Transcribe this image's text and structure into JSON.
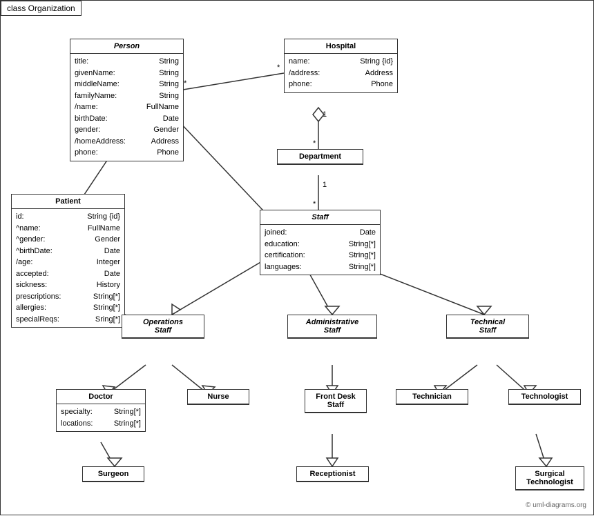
{
  "title": "class Organization",
  "copyright": "© uml-diagrams.org",
  "classes": {
    "person": {
      "name": "Person",
      "italic": true,
      "attrs": [
        [
          "title:",
          "String"
        ],
        [
          "givenName:",
          "String"
        ],
        [
          "middleName:",
          "String"
        ],
        [
          "familyName:",
          "String"
        ],
        [
          "/name:",
          "FullName"
        ],
        [
          "birthDate:",
          "Date"
        ],
        [
          "gender:",
          "Gender"
        ],
        [
          "/homeAddress:",
          "Address"
        ],
        [
          "phone:",
          "Phone"
        ]
      ]
    },
    "hospital": {
      "name": "Hospital",
      "italic": false,
      "attrs": [
        [
          "name:",
          "String {id}"
        ],
        [
          "/address:",
          "Address"
        ],
        [
          "phone:",
          "Phone"
        ]
      ]
    },
    "patient": {
      "name": "Patient",
      "italic": false,
      "attrs": [
        [
          "id:",
          "String {id}"
        ],
        [
          "^name:",
          "FullName"
        ],
        [
          "^gender:",
          "Gender"
        ],
        [
          "^birthDate:",
          "Date"
        ],
        [
          "/age:",
          "Integer"
        ],
        [
          "accepted:",
          "Date"
        ],
        [
          "sickness:",
          "History"
        ],
        [
          "prescriptions:",
          "String[*]"
        ],
        [
          "allergies:",
          "String[*]"
        ],
        [
          "specialReqs:",
          "Sring[*]"
        ]
      ]
    },
    "department": {
      "name": "Department",
      "italic": false,
      "attrs": []
    },
    "staff": {
      "name": "Staff",
      "italic": true,
      "attrs": [
        [
          "joined:",
          "Date"
        ],
        [
          "education:",
          "String[*]"
        ],
        [
          "certification:",
          "String[*]"
        ],
        [
          "languages:",
          "String[*]"
        ]
      ]
    },
    "operations_staff": {
      "name": "Operations\nStaff",
      "italic": true,
      "attrs": []
    },
    "administrative_staff": {
      "name": "Administrative\nStaff",
      "italic": true,
      "attrs": []
    },
    "technical_staff": {
      "name": "Technical\nStaff",
      "italic": true,
      "attrs": []
    },
    "doctor": {
      "name": "Doctor",
      "italic": false,
      "attrs": [
        [
          "specialty:",
          "String[*]"
        ],
        [
          "locations:",
          "String[*]"
        ]
      ]
    },
    "nurse": {
      "name": "Nurse",
      "italic": false,
      "attrs": []
    },
    "front_desk_staff": {
      "name": "Front Desk\nStaff",
      "italic": false,
      "attrs": []
    },
    "technician": {
      "name": "Technician",
      "italic": false,
      "attrs": []
    },
    "technologist": {
      "name": "Technologist",
      "italic": false,
      "attrs": []
    },
    "surgeon": {
      "name": "Surgeon",
      "italic": false,
      "attrs": []
    },
    "receptionist": {
      "name": "Receptionist",
      "italic": false,
      "attrs": []
    },
    "surgical_technologist": {
      "name": "Surgical\nTechnologist",
      "italic": false,
      "attrs": []
    }
  }
}
